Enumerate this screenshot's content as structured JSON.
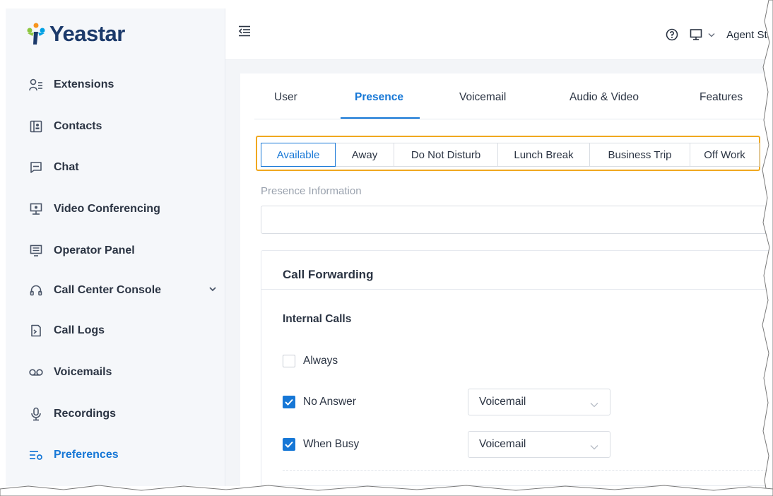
{
  "brand": {
    "name": "Yeastar"
  },
  "sidebar": {
    "items": [
      {
        "label": "Extensions",
        "icon": "extensions-icon"
      },
      {
        "label": "Contacts",
        "icon": "contacts-icon"
      },
      {
        "label": "Chat",
        "icon": "chat-icon"
      },
      {
        "label": "Video Conferencing",
        "icon": "video-conferencing-icon"
      },
      {
        "label": "Operator Panel",
        "icon": "operator-panel-icon"
      },
      {
        "label": "Call Center Console",
        "icon": "headset-icon",
        "expandable": true
      },
      {
        "label": "Call Logs",
        "icon": "call-logs-icon"
      },
      {
        "label": "Voicemails",
        "icon": "voicemail-icon"
      },
      {
        "label": "Recordings",
        "icon": "microphone-icon"
      },
      {
        "label": "Preferences",
        "icon": "preferences-icon",
        "active": true
      }
    ]
  },
  "header": {
    "agent_status": "Agent Sta"
  },
  "tabs": [
    "User",
    "Presence",
    "Voicemail",
    "Audio & Video",
    "Features"
  ],
  "active_tab": "Presence",
  "presence_states": [
    "Available",
    "Away",
    "Do Not Disturb",
    "Lunch Break",
    "Business Trip",
    "Off Work"
  ],
  "active_presence": "Available",
  "presence_info": {
    "label": "Presence Information",
    "value": ""
  },
  "call_forwarding": {
    "title": "Call Forwarding",
    "internal_calls": {
      "title": "Internal Calls",
      "rules": [
        {
          "label": "Always",
          "checked": false,
          "destination": ""
        },
        {
          "label": "No Answer",
          "checked": true,
          "destination": "Voicemail"
        },
        {
          "label": "When Busy",
          "checked": true,
          "destination": "Voicemail"
        }
      ]
    }
  },
  "colors": {
    "accent": "#1677d6",
    "highlight_border": "#f0a81f",
    "brand_navy": "#1c3a6b"
  }
}
